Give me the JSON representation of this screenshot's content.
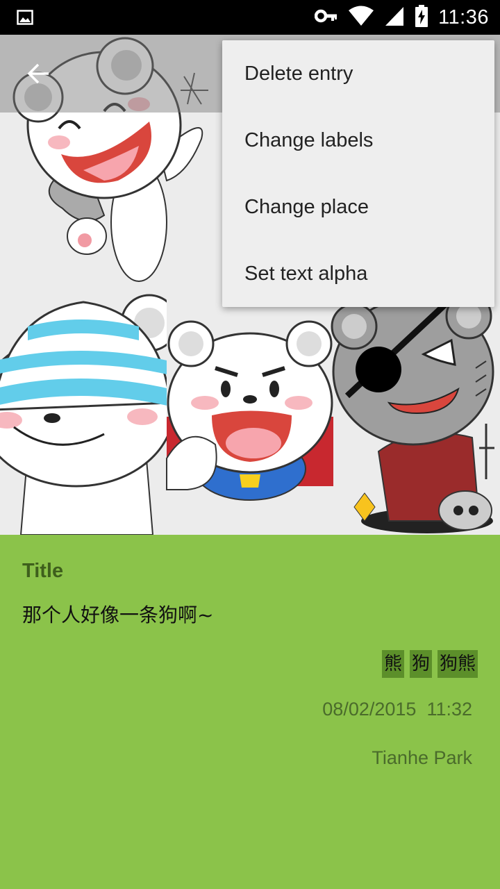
{
  "status_bar": {
    "time": "11:36",
    "icons": [
      "image-notification-icon",
      "vpn-key-icon",
      "wifi-icon",
      "signal-icon",
      "battery-charging-icon"
    ]
  },
  "menu": {
    "items": [
      {
        "label": "Delete entry"
      },
      {
        "label": "Change labels"
      },
      {
        "label": "Change place"
      },
      {
        "label": "Set text alpha"
      }
    ]
  },
  "entry": {
    "title": "Title",
    "text": "那个人好像一条狗啊~",
    "labels": [
      "熊",
      "狗",
      "狗熊"
    ],
    "date": "08/02/2015",
    "time": "11:32",
    "place": "Tianhe Park"
  },
  "colors": {
    "panel_bg": "#8bc34a",
    "label_bg": "#5c8f2a",
    "menu_bg": "#eeeeee"
  }
}
